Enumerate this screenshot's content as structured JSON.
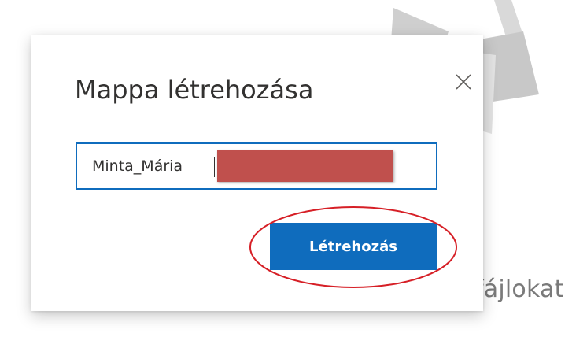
{
  "background": {
    "partial_text": "fájlokat"
  },
  "dialog": {
    "title": "Mappa létrehozása",
    "close_icon": "close-icon",
    "input": {
      "value": "Minta_Mária"
    },
    "create_button_label": "Létrehozás"
  },
  "colors": {
    "accent": "#0f6cbd",
    "redaction": "#c0504d",
    "annotation": "#d61f26"
  }
}
